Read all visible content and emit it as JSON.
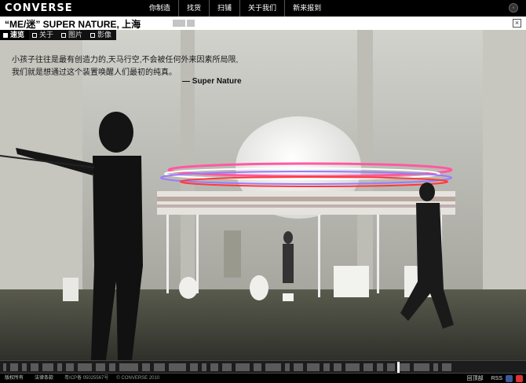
{
  "brand": {
    "logo": "CONVERSE"
  },
  "nav": {
    "items": [
      {
        "label": "你制造"
      },
      {
        "label": "找货"
      },
      {
        "label": "扫铺"
      },
      {
        "label": "关于我们"
      },
      {
        "label": "新来报到"
      }
    ]
  },
  "header": {
    "title": "“ME/迷”   SUPER NATURE, 上海",
    "close": "×"
  },
  "tabs": [
    {
      "label": "速览",
      "active": true
    },
    {
      "label": "关于",
      "active": false
    },
    {
      "label": "图片",
      "active": false
    },
    {
      "label": "影像",
      "active": false
    }
  ],
  "quote": {
    "line1": "小孩子往往是最有创造力的,天马行空,不会被任何外来因素所局限,",
    "line2": "我们就是想通过这个装置唤醒人们最初的纯真。",
    "author": "— Super Nature"
  },
  "timeline": {
    "progress": 0.755
  },
  "footer": {
    "copyright": "版权所有",
    "legal": "法律条款",
    "icp": "粤ICP备 05025567号",
    "converse": "© CONVERSE 2010",
    "back": "回顶部",
    "rss": "RSS"
  },
  "colors": {
    "bg": "#000000",
    "accent": "#ffffff"
  }
}
